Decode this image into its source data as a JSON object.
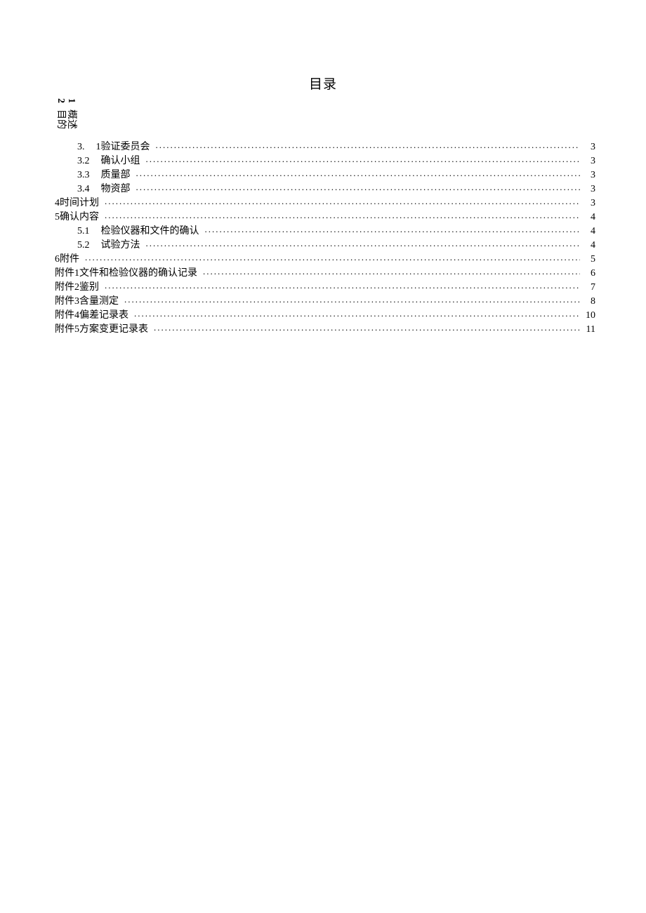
{
  "title": "目录",
  "rotated": [
    {
      "num": "1",
      "text": "概述"
    },
    {
      "num": "2",
      "text": "目的"
    }
  ],
  "toc": [
    {
      "indent": 1,
      "num": "3.",
      "text": "1验证委员会",
      "page": "3"
    },
    {
      "indent": 1,
      "num": "3.2",
      "text": "确认小组",
      "page": "3"
    },
    {
      "indent": 1,
      "num": "3.3",
      "text": "质量部",
      "page": "3"
    },
    {
      "indent": 1,
      "num": "3.4",
      "text": "物资部",
      "page": "3"
    },
    {
      "indent": 0,
      "num": "",
      "text": "4时间计划",
      "page": "3"
    },
    {
      "indent": 0,
      "num": "",
      "text": "5确认内容",
      "page": "4"
    },
    {
      "indent": 1,
      "num": "5.1",
      "text": "检验仪器和文件的确认",
      "page": "4"
    },
    {
      "indent": 1,
      "num": "5.2",
      "text": "试验方法",
      "page": "4"
    },
    {
      "indent": 0,
      "num": "",
      "text": "6附件",
      "page": "5"
    },
    {
      "indent": 0,
      "num": "",
      "text": "附件1文件和检验仪器的确认记录",
      "page": "6"
    },
    {
      "indent": 0,
      "num": "",
      "text": "附件2鉴别",
      "page": "7"
    },
    {
      "indent": 0,
      "num": "",
      "text": "附件3含量测定",
      "page": "8"
    },
    {
      "indent": 0,
      "num": "",
      "text": "附件4偏差记录表",
      "page": "10"
    },
    {
      "indent": 0,
      "num": "",
      "text": "附件5方案变更记录表",
      "page": "11"
    }
  ]
}
